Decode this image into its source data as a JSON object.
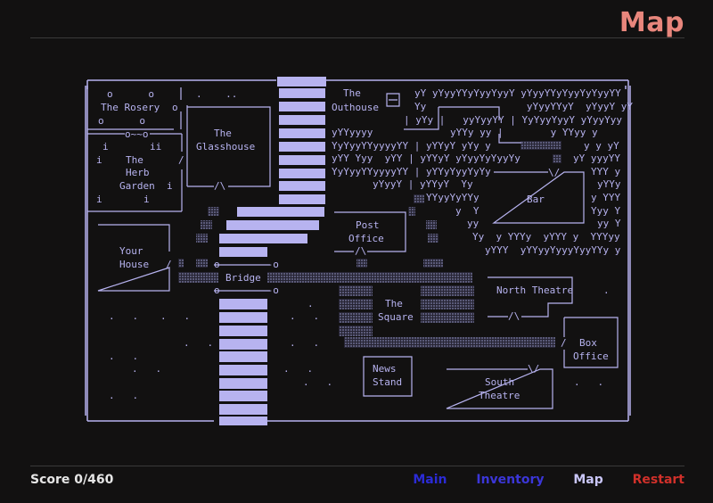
{
  "header": {
    "title": "Map"
  },
  "map": {
    "rooms": {
      "rosery": "The Rosery",
      "glasshouse_1": "The",
      "glasshouse_2": "Glasshouse",
      "herb_1": "The",
      "herb_2": "Herb",
      "herb_3": "Garden",
      "house_1": "Your",
      "house_2": "House",
      "bridge": "Bridge",
      "outhouse_1": "The",
      "outhouse_2": "Outhouse",
      "post_1": "Post",
      "post_2": "Office",
      "bar": "Bar",
      "north_theatre": "North Theatre",
      "square_1": "The",
      "square_2": "Square",
      "box_1": "Box",
      "box_2": "Office",
      "news_1": "News",
      "news_2": "Stand",
      "south_1": "South",
      "south_2": "Theatre"
    },
    "ascii": {
      "rosery_flowers_top": "o      o",
      "rosery_flowers_bottom": "o      o",
      "rosery_door": "o",
      "herb_fence": "o~~o",
      "herb_row1": "i       ii",
      "herb_row2": "i",
      "herb_row3": "/",
      "herb_row4": "i",
      "herb_row5": "i       i",
      "glass_dots": ".    ..",
      "glass_door": "/\\",
      "house_door": "/",
      "bridge_top": "o---------o",
      "bridge_bottom": "o---------o",
      "yard_dots": ".   .",
      "post_door": "/\\",
      "bar_door": "\\/",
      "north_door": "/\\",
      "south_door": "\\/",
      "box_door": "/",
      "sq_dot": ".",
      "nt_dot": ".",
      "field_r1": "yY yYyyYYyYyyYyyY yYyyYYyYyyYyYyyYY",
      "field_r2": "Yy                 yYyyYYyY  yYyyY yY",
      "field_r3": "| yYy |   yyYyyYY | YyYyyYyyY yYyyYyy",
      "field_r4": "yYYy yy |        y YYyy y",
      "field_l4": "yYYyyyy",
      "field_l5": "YyYyyYYyyyyYY | yYYyY yYy y",
      "field_r5": "y y yY",
      "field_l6": "yYY Yyy  yYY | yYYyY yYyyYyYyyYy",
      "field_r6": "yY yyyYY",
      "field_l7": "YyYyyYYyyyyYY | yYYyYyyYyYy",
      "field_r7": "YYY y",
      "field_l8": "yYyyY | yYYyY  Yy",
      "field_r8": "yYYy",
      "field_l9": "YYyyYyYYy",
      "field_r9": "y YYY",
      "field_l10": "y  Y",
      "field_r10": "Yyy Y",
      "field_l11": "yy",
      "field_r11": "yy Y",
      "field_l12": "Yy  y YYYy  yYYY y  YYYyy",
      "field_l13": "yYYY  yYYyyYyyyYyyYYy y"
    }
  },
  "footer": {
    "score": "Score 0/460",
    "nav": {
      "main": "Main",
      "inventory": "Inventory",
      "map": "Map",
      "restart": "Restart"
    }
  },
  "colors": {
    "background": "#121111",
    "map_line": "#b7b3f0",
    "title": "#e8867c",
    "nav_main": "#2b2bd6",
    "nav_inventory": "#3b36d8",
    "nav_map": "#c9c6f7",
    "nav_restart": "#d0302a"
  }
}
